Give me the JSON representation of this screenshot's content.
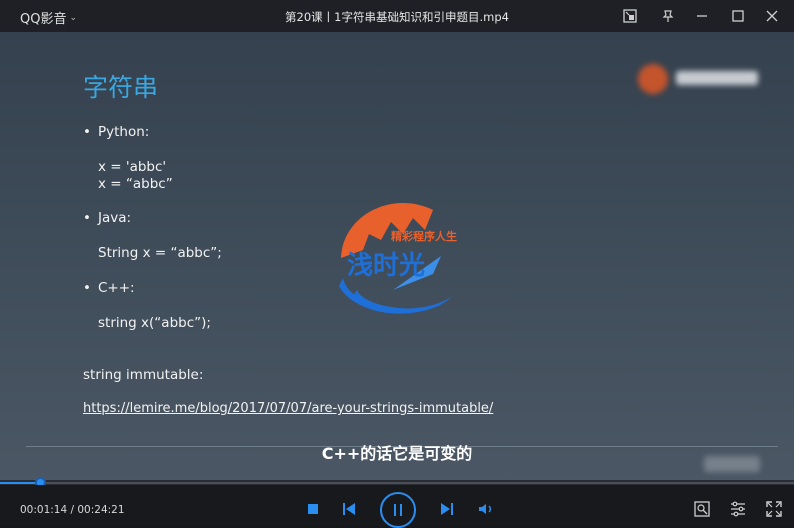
{
  "titlebar": {
    "app_name": "QQ影音",
    "file_title": "第20课丨1字符串基础知识和引申题目.mp4"
  },
  "slide": {
    "title": "字符串",
    "bullets": [
      {
        "label": "Python:",
        "code": [
          "x = 'abbc'",
          "x = “abbc”"
        ]
      },
      {
        "label": "Java:",
        "code": [
          "String x = “abbc”;"
        ]
      },
      {
        "label": "C++:",
        "code": [
          "string x(“abbc”);"
        ]
      }
    ],
    "note": "string immutable:",
    "link": "https://lemire.me/blog/2017/07/07/are-your-strings-immutable/"
  },
  "watermark": {
    "line1": "精彩程序人生",
    "line2": "浅时光"
  },
  "subtitle": "C++的话它是可变的",
  "player": {
    "current_time": "00:01:14",
    "total_time": "00:24:21",
    "time_display": "00:01:14 / 00:24:21",
    "progress": 0.0507
  },
  "colors": {
    "accent": "#2a8ef0",
    "slide_title": "#39a8e2",
    "watermark_orange": "#e8602c",
    "watermark_blue": "#1e6fd8"
  }
}
